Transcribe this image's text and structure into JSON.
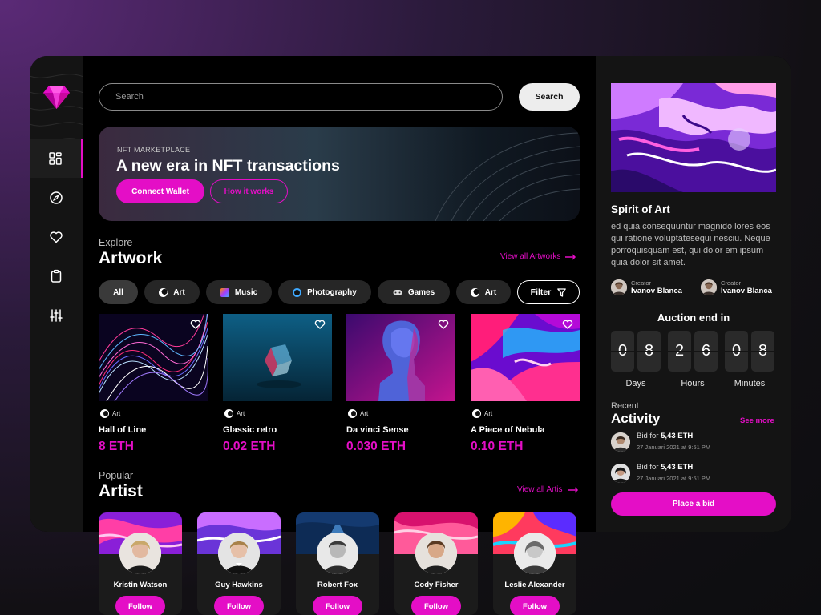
{
  "search": {
    "placeholder": "Search",
    "button_label": "Search"
  },
  "nav": {
    "items": [
      {
        "icon": "dashboard-icon",
        "active": true
      },
      {
        "icon": "compass-icon",
        "active": false
      },
      {
        "icon": "heart-icon",
        "active": false
      },
      {
        "icon": "clipboard-icon",
        "active": false
      },
      {
        "icon": "sliders-icon",
        "active": false
      }
    ]
  },
  "hero": {
    "kicker": "NFT MARKETPLACE",
    "title": "A new era in NFT transactions",
    "primary_label": "Connect Wallet",
    "secondary_label": "How it works"
  },
  "artwork": {
    "kicker": "Explore",
    "title": "Artwork",
    "view_all": "View all Artworks",
    "chips": [
      "All",
      "Art",
      "Music",
      "Photography",
      "Games",
      "Art"
    ],
    "filter_label": "Filter",
    "items": [
      {
        "category": "Art",
        "name": "Hall of Line",
        "price": "8 ETH"
      },
      {
        "category": "Art",
        "name": "Glassic retro",
        "price": "0.02 ETH"
      },
      {
        "category": "Art",
        "name": "Da vinci Sense",
        "price": "0.030 ETH"
      },
      {
        "category": "Art",
        "name": "A Piece of Nebula",
        "price": "0.10 ETH"
      }
    ]
  },
  "artists": {
    "kicker": "Popular",
    "title": "Artist",
    "view_all": "View all Artis",
    "follow_label": "Follow",
    "items": [
      {
        "name": "Kristin Watson"
      },
      {
        "name": "Guy Hawkins"
      },
      {
        "name": "Robert Fox"
      },
      {
        "name": "Cody Fisher"
      },
      {
        "name": "Leslie Alexander"
      }
    ]
  },
  "feature": {
    "title": "Spirit of Art",
    "description": "ed quia consequuntur magnido lores eos qui ratione voluptatesequi nesciu. Neque porroquisquam est, qui dolor em ipsum quia dolor sit amet.",
    "creators": [
      {
        "label": "Creator",
        "name": "Ivanov Blanca"
      },
      {
        "label": "Creator",
        "name": "Ivanov Blanca"
      }
    ]
  },
  "auction": {
    "title": "Auction end in",
    "digits": [
      "0",
      "8",
      "2",
      "6",
      "0",
      "8"
    ],
    "units": [
      "Days",
      "Hours",
      "Minutes"
    ]
  },
  "activity": {
    "kicker": "Recent",
    "title": "Activity",
    "see_more": "See more",
    "items": [
      {
        "prefix": "Bid for",
        "amount": "5,43 ETH",
        "time": "27 Januari 2021 at 9:51 PM"
      },
      {
        "prefix": "Bid for",
        "amount": "5,43 ETH",
        "time": "27 Januari 2021 at 9:51 PM"
      }
    ],
    "bid_label": "Place a bid"
  },
  "colors": {
    "accent": "#e40ec6",
    "panel": "#141414",
    "background": "#000000"
  }
}
